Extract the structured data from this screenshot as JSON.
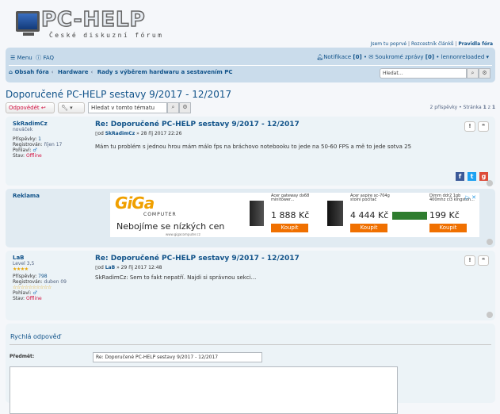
{
  "header": {
    "logo_text": "PC-HELP",
    "tagline": "České diskuzní fórum",
    "toplinks": {
      "a": "Jsem tu poprvé",
      "b": "Rozcestník článků",
      "c": "Pravidla fóra"
    }
  },
  "nav": {
    "menu": "Menu",
    "faq": "FAQ",
    "notif_label": "Notifikace",
    "notif_count": "[0]",
    "pm_label": "Soukromé zprávy",
    "pm_count": "[0]",
    "user": "lennonreloaded ▾",
    "crumbs": [
      "Obsah fóra",
      "Hardware",
      "Rady s výběrem hardwaru a sestavením PC"
    ],
    "search_placeholder": "Hledat…"
  },
  "page_title": "Doporučené PC-HELP sestavy 9/2017 - 12/2017",
  "actions": {
    "reply": "Odpovědět",
    "topic_search_placeholder": "Hledat v tomto tématu",
    "pagination_prefix": "2 příspěvky • Stránka",
    "page": "1",
    "of": "z",
    "total": "1"
  },
  "posts": [
    {
      "user": "SkRadimCz",
      "rank": "nováček",
      "posts_label": "Příspěvky:",
      "posts": "1",
      "reg_label": "Registrován:",
      "reg": "říjen 17",
      "gender_label": "Pohlaví:",
      "status_label": "Stav:",
      "status": "Offline",
      "title": "Re: Doporučené PC-HELP sestavy 9/2017 - 12/2017",
      "by": "od",
      "author": "SkRadimCz",
      "date": "» 28 říj 2017 22:26",
      "text": "Mám tu problém s jednou hrou mám málo fps na bráchovo notebooku to jede na 50-60 FPS a mě to jede sotva 25"
    },
    {
      "user": "LaB",
      "rank": "Level 3,5",
      "posts_label": "Příspěvky:",
      "posts": "798",
      "reg_label": "Registrován:",
      "reg": "duben 09",
      "gender_label": "Pohlaví:",
      "status_label": "Stav:",
      "status": "Offline",
      "title": "Re: Doporučené PC-HELP sestavy 9/2017 - 12/2017",
      "by": "od",
      "author": "LaB",
      "date": "» 29 říj 2017 12:48",
      "text": "SkRadimCz: Sem to fakt nepatří. Najdi si správnou sekci..."
    }
  ],
  "ad": {
    "label": "Reklama",
    "brand": "GiGa",
    "brand_sub": "COMPUTER",
    "slogan": "Nebojíme se nízkých cen",
    "url": "www.gigacomputer.cz",
    "products": [
      {
        "name": "Acer gateway dx68 minitower...",
        "price": "1 888 Kč",
        "buy": "Koupit"
      },
      {
        "name": "Acer aspire xc-704g stolní počítač",
        "price": "4 444 Kč",
        "buy": "Koupit"
      },
      {
        "name": "Dimm ddr2 1gb 400mhz cl3 kingston...",
        "price": "199 Kč",
        "buy": "Koupit"
      }
    ]
  },
  "quick_reply": {
    "title": "Rychlá odpověď",
    "subject_label": "Předmět:",
    "subject_value": "Re: Doporučené PC-HELP sestavy 9/2017 - 12/2017"
  },
  "colors": {
    "link": "#105289",
    "nav_bg": "#cadceb",
    "post_bg1": "#ecf3f7",
    "post_bg2": "#e1ebf2",
    "accent_red": "#d31141"
  }
}
